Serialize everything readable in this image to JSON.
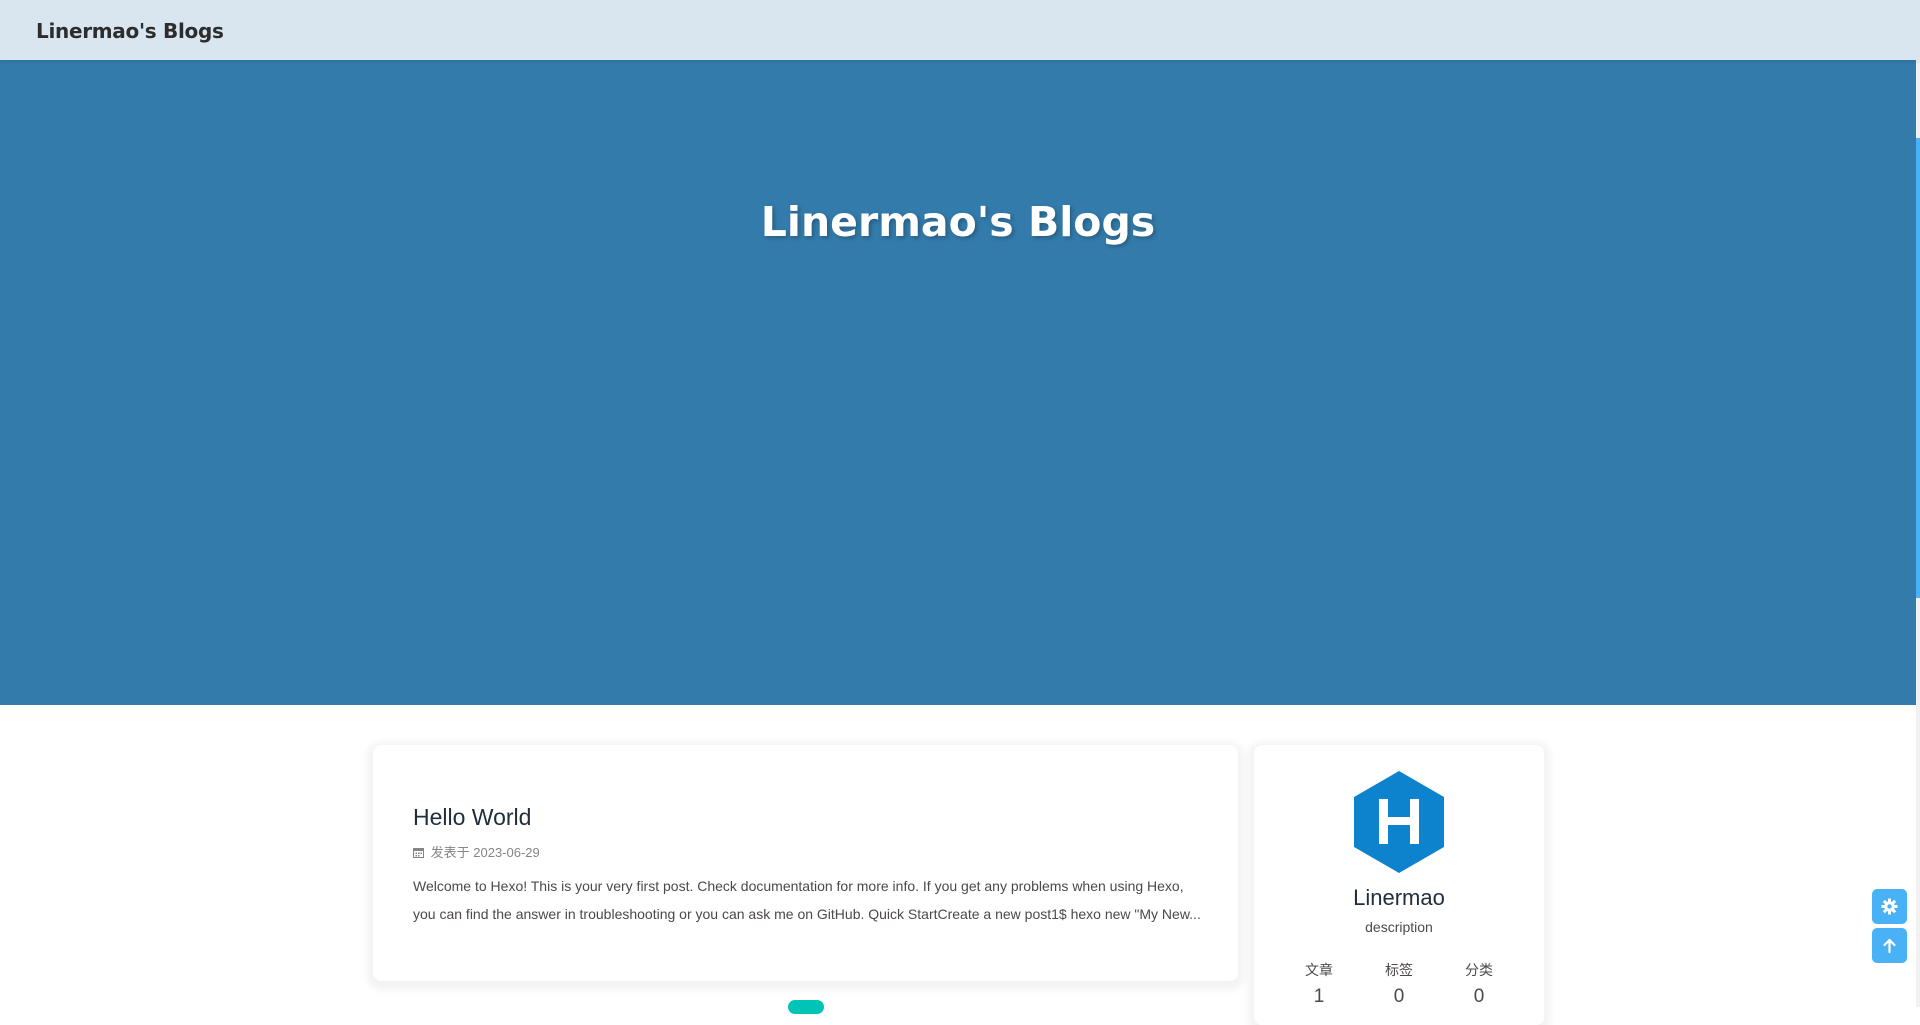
{
  "navbar": {
    "site_name": "Linermao's Blogs"
  },
  "hero": {
    "title": "Linermao's Blogs",
    "scroll_icon": "chevron-down-icon"
  },
  "post": {
    "title": "Hello World",
    "meta_label": "发表于",
    "date": "2023-06-29",
    "excerpt": "Welcome to Hexo! This is your very first post. Check documentation for more info. If you get any problems when using Hexo, you can find the answer in troubleshooting or you can ask me on GitHub. Quick StartCreate a new post1$ hexo new \"My New..."
  },
  "author": {
    "name": "Linermao",
    "description": "description",
    "stats": [
      {
        "label": "文章",
        "value": "1"
      },
      {
        "label": "标签",
        "value": "0"
      },
      {
        "label": "分类",
        "value": "0"
      }
    ]
  },
  "side_buttons": {
    "settings_icon": "gear-icon",
    "to_top_icon": "arrow-up-icon"
  },
  "colors": {
    "navbar_bg": "#d9e6ef",
    "hero_bg": "#337bab",
    "accent": "#49b1f5",
    "avatar_hex": "#0e83cd",
    "pagination": "#00c4b6"
  }
}
